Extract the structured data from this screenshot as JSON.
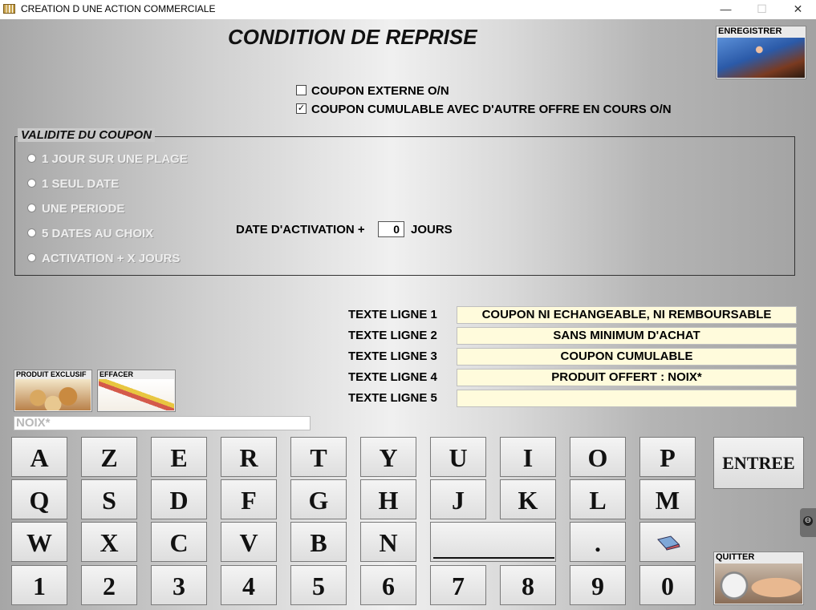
{
  "window": {
    "title": "CREATION D UNE ACTION COMMERCIALE",
    "minimize_glyph": "—",
    "maximize_glyph": "☐",
    "close_glyph": "✕"
  },
  "page_title": "CONDITION DE REPRISE",
  "buttons": {
    "save_label": "ENREGISTRER",
    "exclusive_product_label": "PRODUIT EXCLUSIF",
    "erase_label": "EFFACER",
    "quit_label": "QUITTER",
    "enter_label": "ENTREE"
  },
  "checkboxes": [
    {
      "label": "COUPON EXTERNE O/N",
      "checked": false,
      "mark": ""
    },
    {
      "label": "COUPON CUMULABLE AVEC D'AUTRE OFFRE EN COURS O/N",
      "checked": true,
      "mark": "✓"
    }
  ],
  "validity": {
    "title": "VALIDITE DU COUPON",
    "options": [
      "1 JOUR SUR UNE PLAGE",
      "1 SEUL DATE",
      "UNE PERIODE",
      "5 DATES AU CHOIX",
      "ACTIVATION + X JOURS"
    ],
    "activation_label": "DATE D'ACTIVATION +",
    "activation_value": "0",
    "activation_unit": "JOURS"
  },
  "text_lines": [
    {
      "label": "TEXTE LIGNE 1",
      "value": "COUPON NI ECHANGEABLE, NI REMBOURSABLE"
    },
    {
      "label": "TEXTE LIGNE 2",
      "value": "SANS MINIMUM D'ACHAT"
    },
    {
      "label": "TEXTE LIGNE 3",
      "value": "COUPON CUMULABLE"
    },
    {
      "label": "TEXTE LIGNE 4",
      "value": "PRODUIT OFFERT : NOIX*"
    },
    {
      "label": "TEXTE LIGNE 5",
      "value": ""
    }
  ],
  "search_value": "NOIX*",
  "keyboard": {
    "row1": [
      "A",
      "Z",
      "E",
      "R",
      "T",
      "Y",
      "U",
      "I",
      "O",
      "P"
    ],
    "row2": [
      "Q",
      "S",
      "D",
      "F",
      "G",
      "H",
      "J",
      "K",
      "L",
      "M"
    ],
    "row3": [
      "W",
      "X",
      "C",
      "V",
      "B",
      "N"
    ],
    "dot": ".",
    "row4": [
      "1",
      "2",
      "3",
      "4",
      "5",
      "6",
      "7",
      "8",
      "9",
      "0"
    ]
  },
  "icons": {
    "app": "app-icon",
    "side_tab_glyph": "⊖"
  }
}
